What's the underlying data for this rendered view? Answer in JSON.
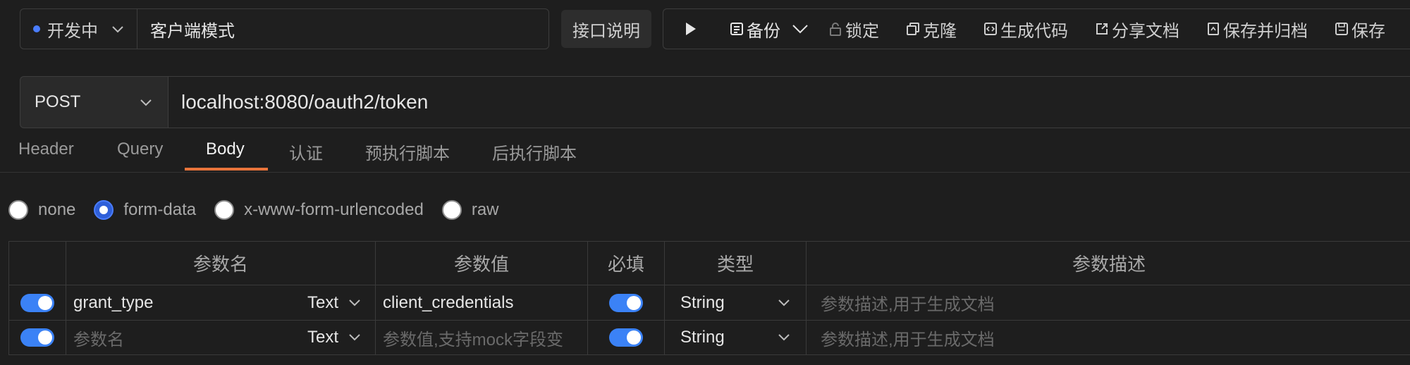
{
  "header": {
    "status": "开发中",
    "name": "客户端模式",
    "doc_button": "接口说明",
    "toolbar": {
      "backup": "备份",
      "lock": "锁定",
      "clone": "克隆",
      "gen_code": "生成代码",
      "share_doc": "分享文档",
      "save_archive": "保存并归档",
      "save": "保存"
    }
  },
  "request": {
    "method": "POST",
    "url": "localhost:8080/oauth2/token"
  },
  "tabs": [
    "Header",
    "Query",
    "Body",
    "认证",
    "预执行脚本",
    "后执行脚本"
  ],
  "active_tab": "Body",
  "body_types": [
    "none",
    "form-data",
    "x-www-form-urlencoded",
    "raw"
  ],
  "selected_body_type": "form-data",
  "table": {
    "headers": [
      "参数名",
      "参数值",
      "必填",
      "类型",
      "参数描述"
    ],
    "rows": [
      {
        "enabled": true,
        "name": "grant_type",
        "name_type": "Text",
        "value": "client_credentials",
        "required": true,
        "type": "String",
        "description_placeholder": "参数描述,用于生成文档"
      },
      {
        "enabled": true,
        "name_placeholder": "参数名",
        "name_type": "Text",
        "value_placeholder": "参数值,支持mock字段变",
        "required": true,
        "type": "String",
        "description_placeholder": "参数描述,用于生成文档"
      }
    ]
  },
  "colors": {
    "accent": "#4a7dff",
    "tab_underline": "#e8743b",
    "toggle_on": "#3b82f6"
  }
}
